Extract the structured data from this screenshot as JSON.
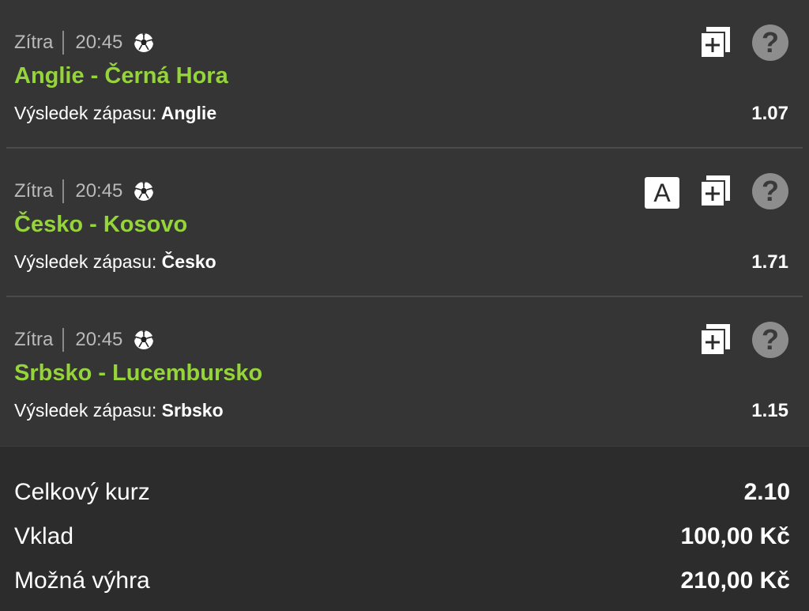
{
  "bets": [
    {
      "day": "Zítra",
      "time": "20:45",
      "sport_icon": "soccer-ball-icon",
      "match": "Anglie - Černá Hora",
      "market": "Výsledek zápasu:",
      "pick": "Anglie",
      "odds": "1.07",
      "badge": ""
    },
    {
      "day": "Zítra",
      "time": "20:45",
      "sport_icon": "soccer-ball-icon",
      "match": "Česko - Kosovo",
      "market": "Výsledek zápasu:",
      "pick": "Česko",
      "odds": "1.71",
      "badge": "A"
    },
    {
      "day": "Zítra",
      "time": "20:45",
      "sport_icon": "soccer-ball-icon",
      "match": "Srbsko - Lucembursko",
      "market": "Výsledek zápasu:",
      "pick": "Srbsko",
      "odds": "1.15",
      "badge": ""
    }
  ],
  "summary": {
    "total_odds_label": "Celkový kurz",
    "total_odds": "2.10",
    "stake_label": "Vklad",
    "stake": "100,00 Kč",
    "win_label": "Možná výhra",
    "win": "210,00 Kč"
  },
  "colors": {
    "match_green": "#95d43a",
    "panel": "#353535",
    "summary_bg": "#2c2c2c",
    "help_grey": "#8d8d8d"
  },
  "icons": {
    "add": "add-to-slip-icon",
    "help": "help-icon",
    "help_glyph": "?"
  }
}
